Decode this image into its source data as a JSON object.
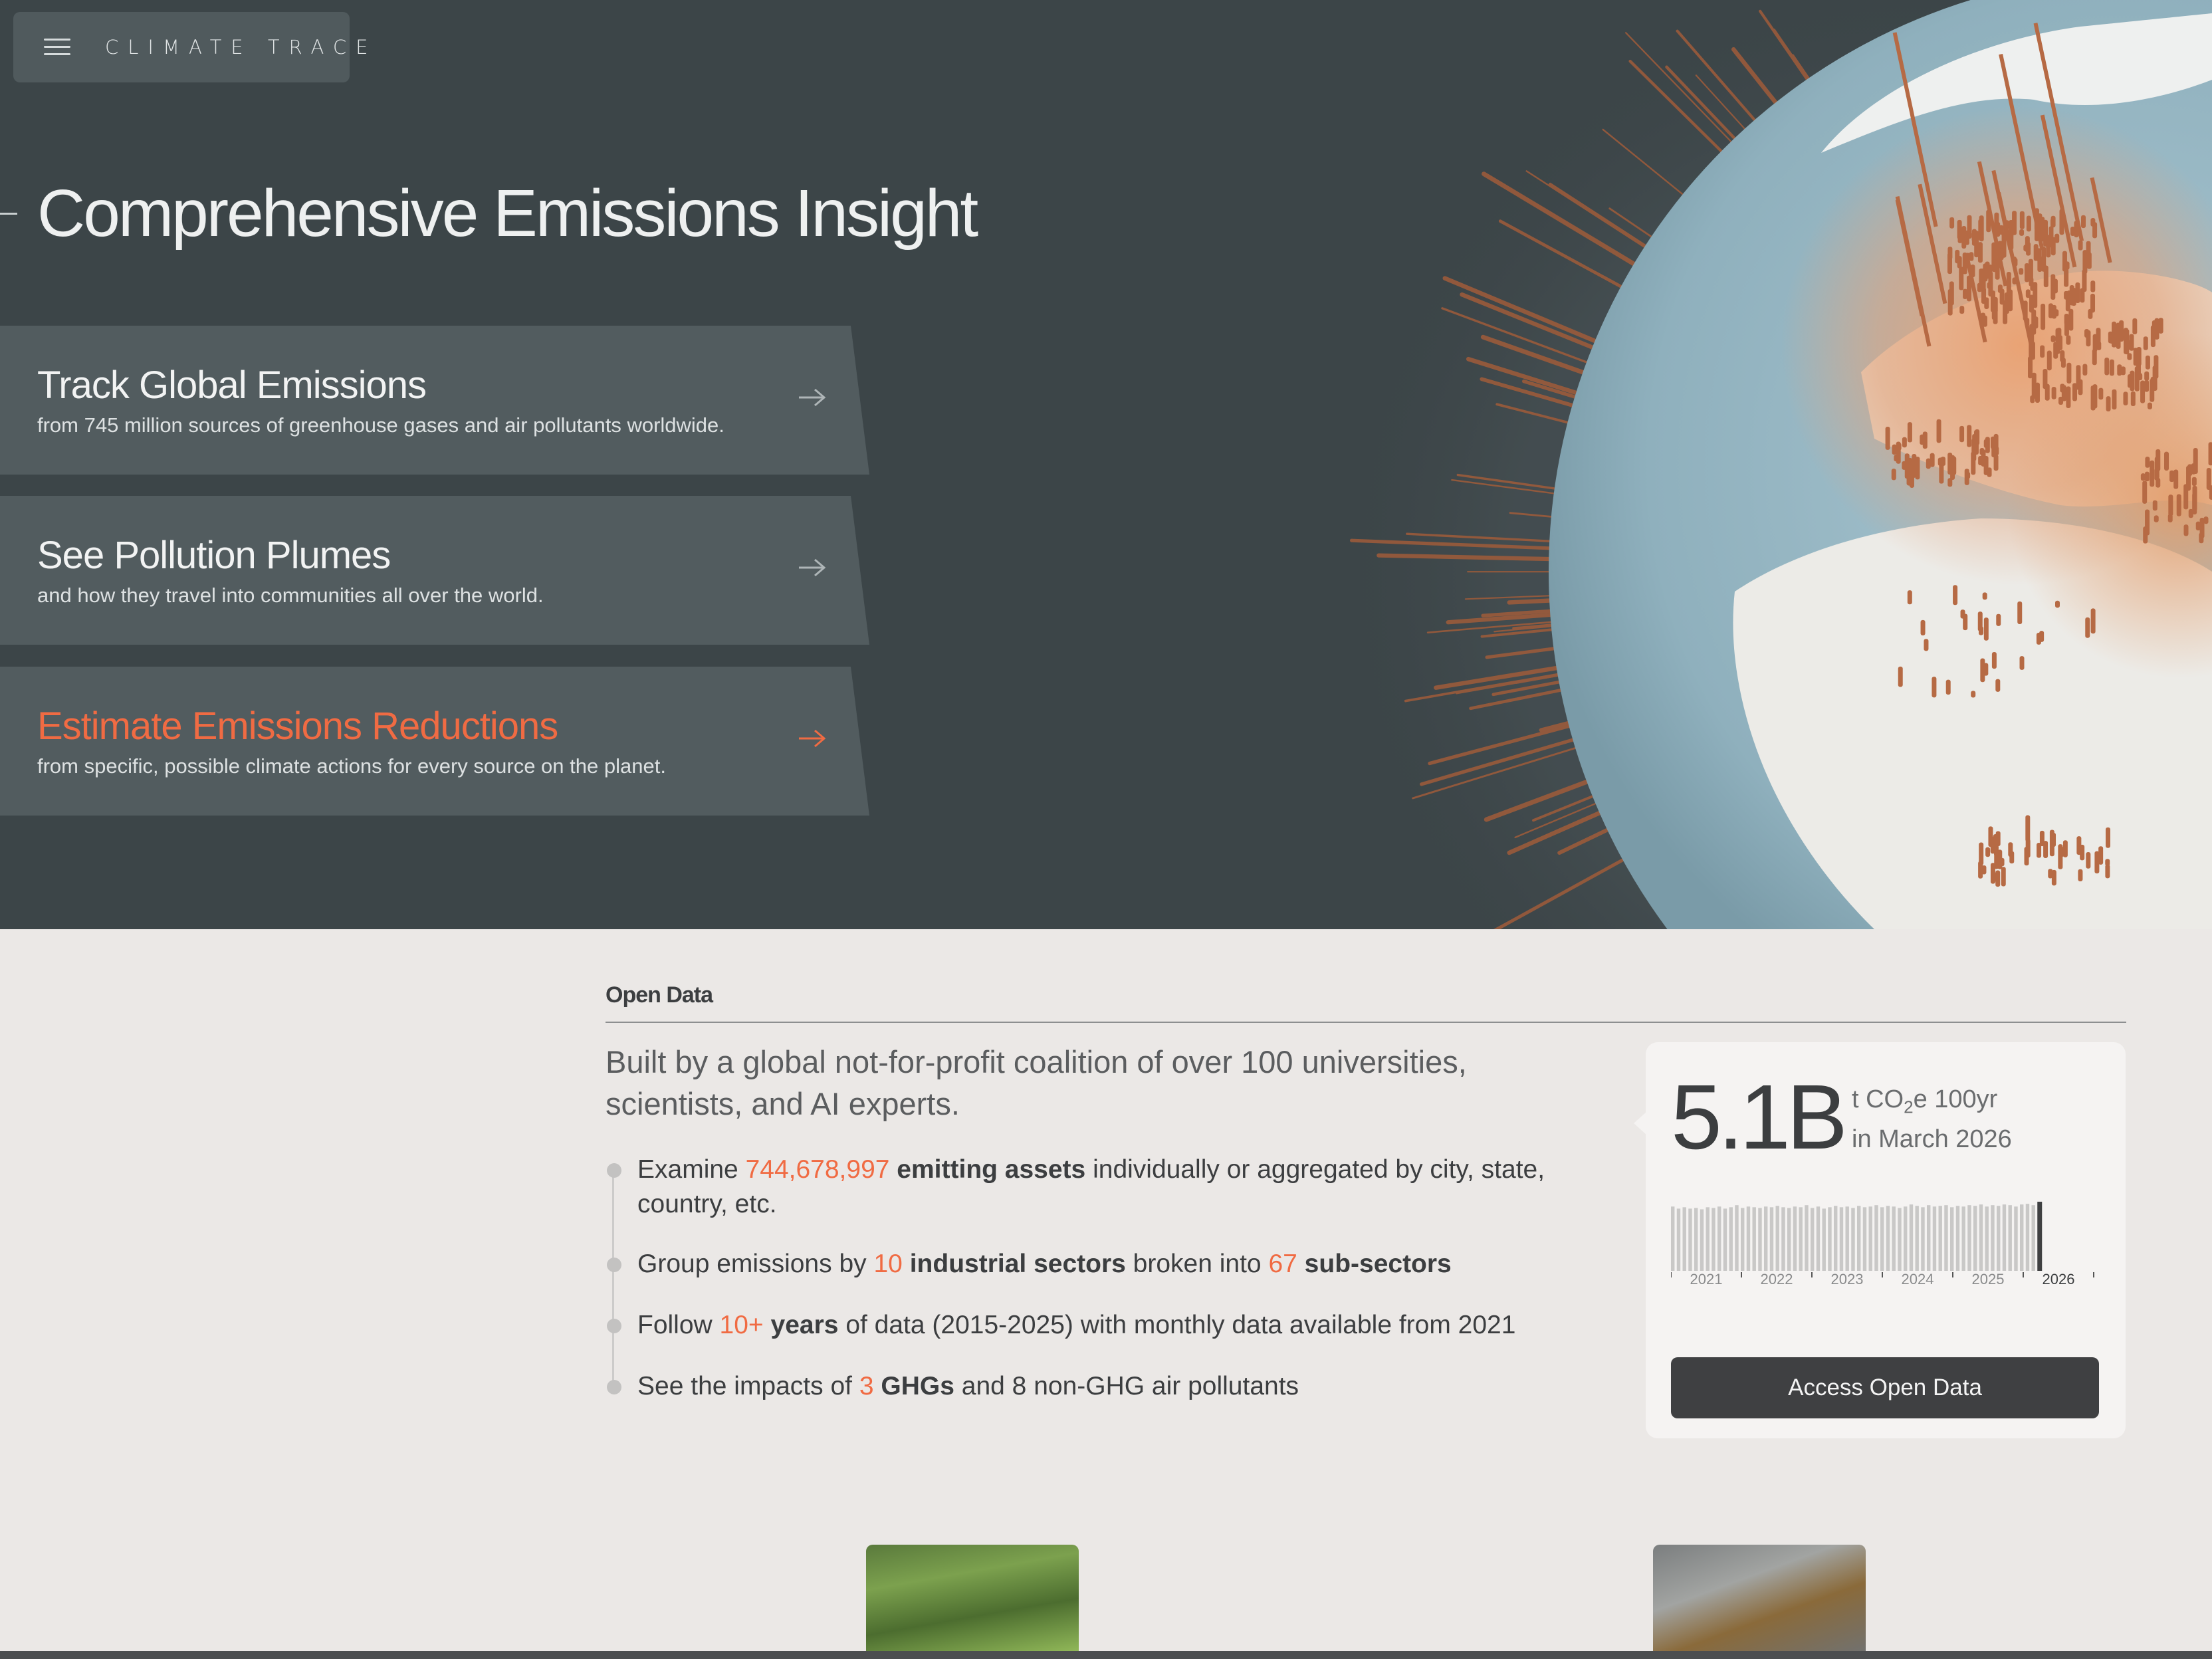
{
  "brand": {
    "name": "CLIMATE TRACE"
  },
  "hero": {
    "title": "Comprehensive Emissions Insight",
    "cards": [
      {
        "title": "Track Global Emissions",
        "subtitle": "from 745 million sources of greenhouse gases and air pollutants worldwide."
      },
      {
        "title": "See Pollution Plumes",
        "subtitle": "and how they travel into communities all over the world."
      },
      {
        "title": "Estimate Emissions Reductions",
        "subtitle": "from specific, possible climate actions for every source on the planet."
      }
    ]
  },
  "open_data": {
    "label": "Open Data",
    "lead": "Built by a global not-for-profit coalition of over 100 universities, scientists, and AI experts.",
    "bullets": [
      {
        "pre": "Examine ",
        "num": "744,678,997",
        "bold": " emitting assets",
        "post": " individually or aggregated by city, state, country, etc."
      },
      {
        "pre": "Group emissions by ",
        "num": "10",
        "bold": " industrial sectors",
        "mid": " broken into ",
        "num2": "67",
        "bold2": " sub-sectors"
      },
      {
        "pre": "Follow ",
        "num": "10+",
        "bold": " years",
        "post": " of data (2015-2025) with monthly data available from 2021"
      },
      {
        "pre": "See the impacts of ",
        "num": "3",
        "bold": " GHGs",
        "post": " and 8 non-GHG air pollutants"
      }
    ],
    "stat": {
      "value": "5.1B",
      "unit_prefix": "t CO",
      "unit_sub": "2",
      "unit_suffix": "e 100yr",
      "period": "in March 2026",
      "button": "Access Open Data"
    }
  },
  "chart_data": {
    "type": "bar",
    "x_tick_labels": [
      "2021",
      "2022",
      "2023",
      "2024",
      "2025",
      "2026"
    ],
    "values": [
      0.93,
      0.9,
      0.92,
      0.9,
      0.91,
      0.89,
      0.92,
      0.91,
      0.93,
      0.9,
      0.92,
      0.95,
      0.91,
      0.93,
      0.92,
      0.91,
      0.93,
      0.92,
      0.94,
      0.92,
      0.91,
      0.93,
      0.92,
      0.95,
      0.91,
      0.93,
      0.9,
      0.92,
      0.94,
      0.92,
      0.93,
      0.91,
      0.94,
      0.92,
      0.93,
      0.95,
      0.92,
      0.94,
      0.93,
      0.91,
      0.93,
      0.96,
      0.94,
      0.92,
      0.95,
      0.93,
      0.94,
      0.95,
      0.92,
      0.94,
      0.93,
      0.95,
      0.94,
      0.96,
      0.93,
      0.95,
      0.94,
      0.96,
      0.95,
      0.93,
      0.96,
      0.97,
      0.95,
      1.0
    ],
    "highlight_last": true,
    "bar_color": "#c9c8c7",
    "highlight_color": "#3f4042"
  },
  "colors": {
    "accent": "#f06b43",
    "hero_bg": "#3c4548",
    "card_bg": "#525c5f",
    "page_bg": "#ebe8e6"
  },
  "icons": {
    "menu": "hamburger-icon",
    "arrow": "arrow-right-icon"
  }
}
